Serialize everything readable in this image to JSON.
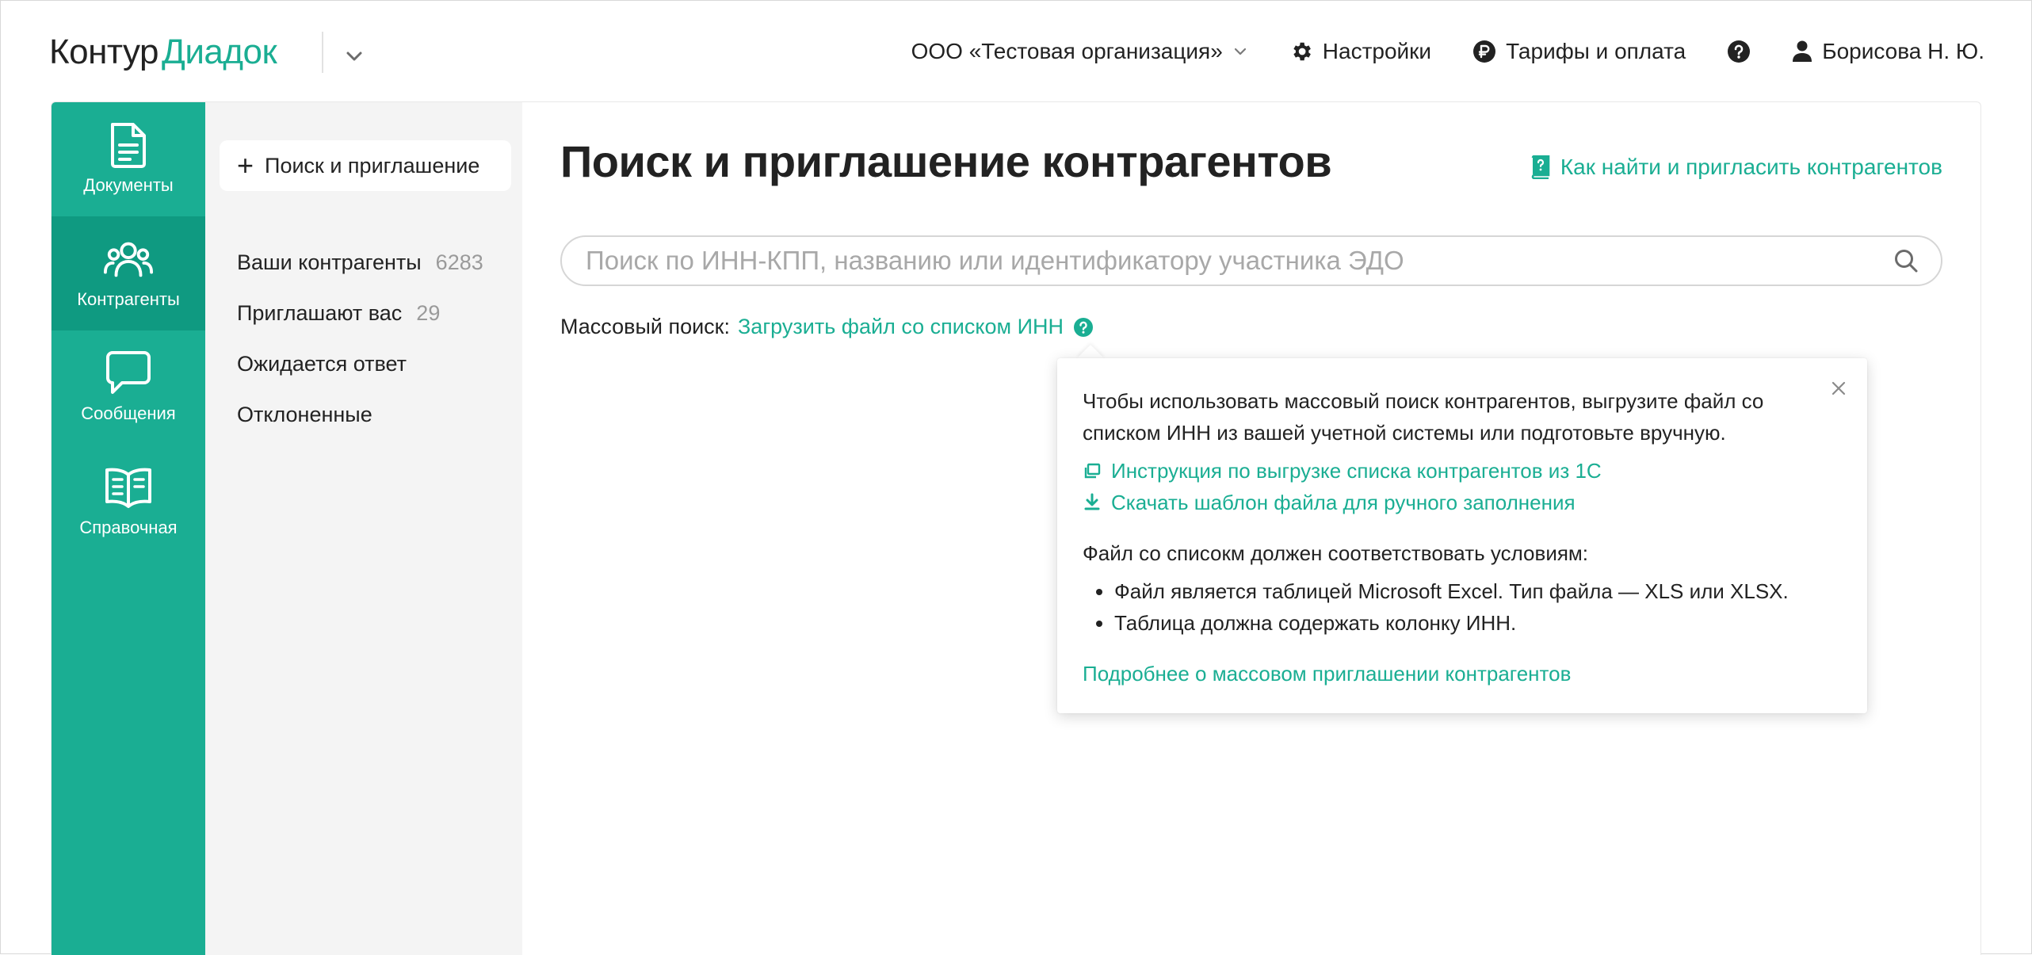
{
  "colors": {
    "accent": "#1aae93",
    "accent_dark": "#0f9a81",
    "text": "#222222",
    "muted": "#9a9a9a",
    "subnav_bg": "#f4f4f4"
  },
  "header": {
    "logo_part1": "Контур",
    "logo_part2": "Диадок",
    "organization": "ООО «Тестовая организация»",
    "settings": "Настройки",
    "tariffs": "Тарифы и оплата",
    "user": "Борисова Н. Ю."
  },
  "rail": {
    "items": [
      {
        "label": "Документы",
        "icon": "document-icon"
      },
      {
        "label": "Контрагенты",
        "icon": "people-icon",
        "active": true
      },
      {
        "label": "Сообщения",
        "icon": "chat-icon"
      },
      {
        "label": "Справочная",
        "icon": "book-icon"
      }
    ]
  },
  "subnav": {
    "button_label": "Поиск и приглашение",
    "items": [
      {
        "label": "Ваши контрагенты",
        "count": "6283"
      },
      {
        "label": "Приглашают вас",
        "count": "29"
      },
      {
        "label": "Ожидается ответ"
      },
      {
        "label": "Отклоненные"
      }
    ]
  },
  "main": {
    "title": "Поиск и приглашение контрагентов",
    "help_link": "Как найти и пригласить контрагентов",
    "search_placeholder": "Поиск по ИНН-КПП, названию или идентификатору участника ЭДО",
    "mass_search_label": "Массовый поиск:",
    "mass_search_link": "Загрузить файл со списком ИНН"
  },
  "popover": {
    "intro": "Чтобы использовать массовый поиск контрагентов, выгрузите файл со списком ИНН из вашей учетной системы или подготовьте вручную.",
    "link_instruction": "Инструкция по выгрузке списка контрагентов из 1С",
    "link_template": "Скачать шаблон файла для ручного заполнения",
    "conditions_title": "Файл со списокм должен соответствовать условиям:",
    "conditions": [
      "Файл является таблицей Microsoft Excel. Тип файла — XLS или XLSX.",
      "Таблица должна содержать колонку ИНН."
    ],
    "more_link": "Подробнее о массовом приглашении контрагентов"
  }
}
